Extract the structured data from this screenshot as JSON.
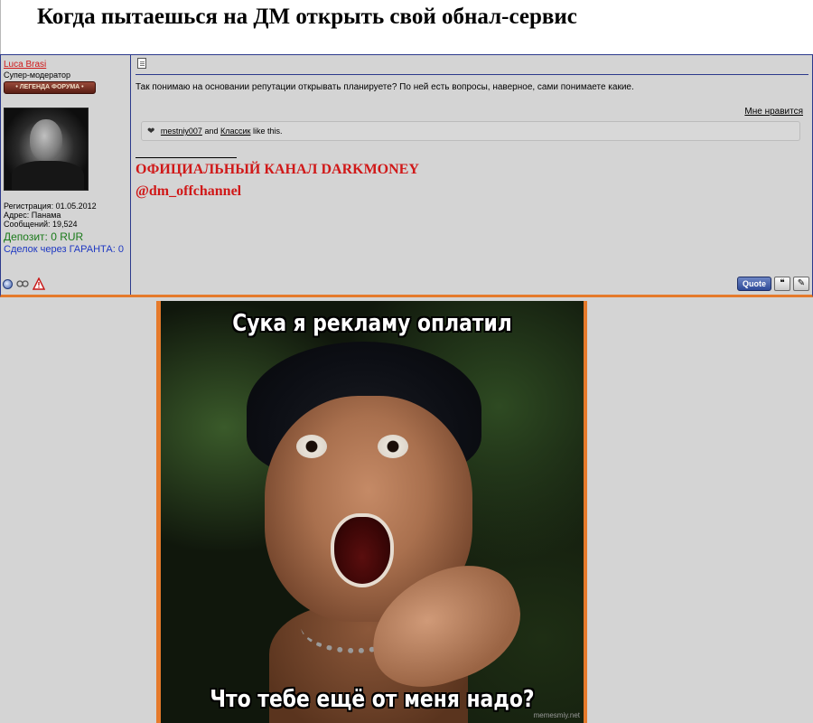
{
  "header": {
    "title": "Когда пытаешься на ДМ открыть свой обнал-сервис"
  },
  "user": {
    "username": "Luca Brasi",
    "title": "Супер-модератор",
    "rank_badge": "• ЛЕГЕНДА ФОРУМА •",
    "registration": "Регистрация: 01.05.2012",
    "address": "Адрес: Панама",
    "posts": "Сообщений: 19,524",
    "deposit": "Депозит: 0 RUR",
    "guarantee_deals": "Сделок через ГАРАНТА: 0",
    "icons": [
      "online-status-icon",
      "reputation-icon",
      "report-icon"
    ]
  },
  "post": {
    "text": "Так понимаю на основании репутации открывать планируете? По ней есть вопросы, наверное, сами понимаете какие.",
    "like_label": "Мне нравится",
    "likes": {
      "user1": "mestniy007",
      "and_text": "and",
      "user2": "Классик",
      "suffix": "like this."
    },
    "signature_line1": "ОФИЦИАЛЬНЫЙ КАНАЛ DARKMONEY",
    "signature_line2": "@dm_offchannel",
    "quote_label": "Quote"
  },
  "meme": {
    "top_text": "Сука я рекламу оплатил",
    "bottom_text": "Что тебе ещё от меня надо?",
    "watermark": "memesmiy.net"
  },
  "colors": {
    "post_bg": "#d4d4d4",
    "border_blue": "#2c3a8c",
    "accent_orange": "#e57a2b",
    "signature_red": "#d01818",
    "deposit_green": "#1a7a1a",
    "guarantee_blue": "#1e38c2"
  }
}
